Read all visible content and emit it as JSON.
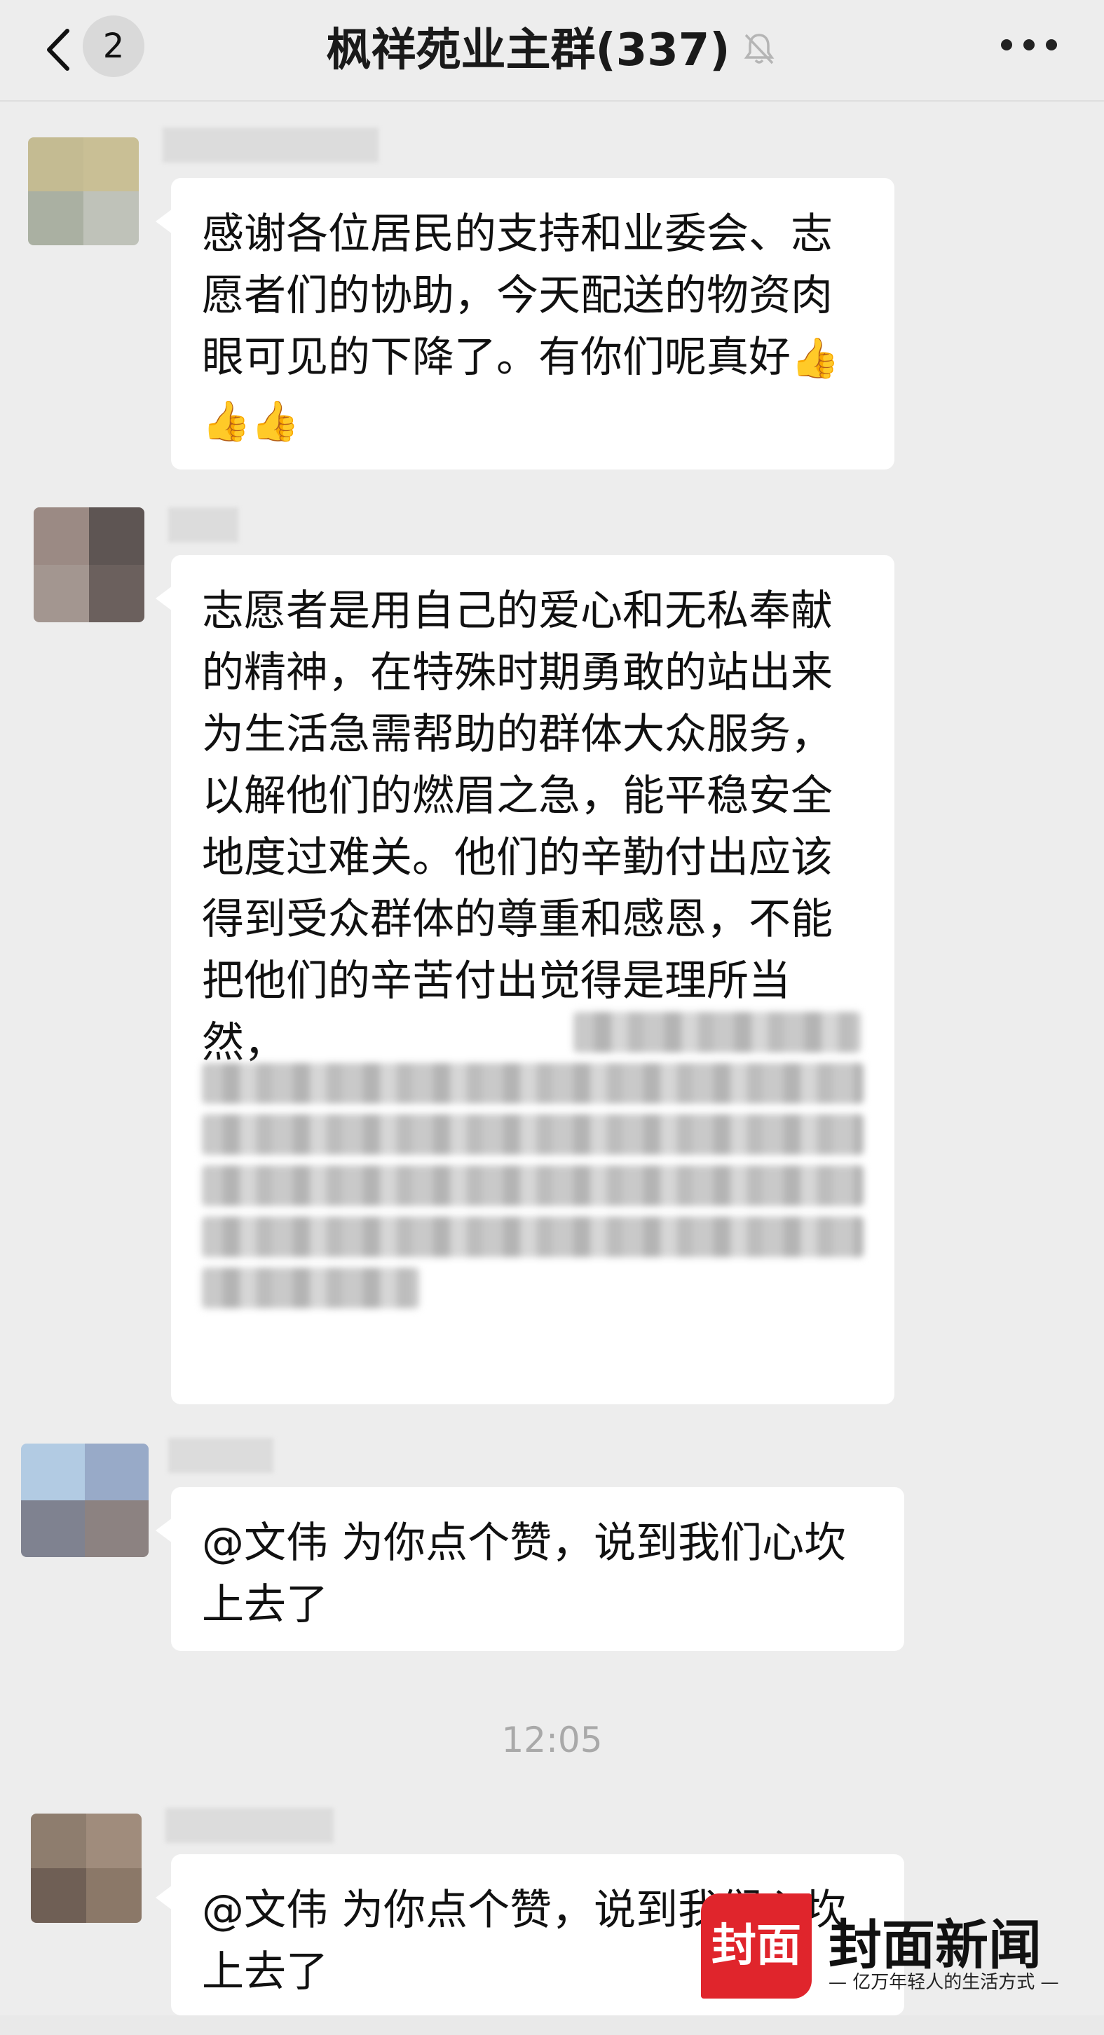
{
  "header": {
    "back_count": "2",
    "title": "枫祥苑业主群(337)",
    "mute_icon": "bell-muted-icon",
    "more_icon": "more-dots-icon"
  },
  "messages": [
    {
      "text": "感谢各位居民的支持和业委会、志愿者们的协助，今天配送的物资肉眼可见的下降了。有你们呢真好",
      "emoji": "👍👍👍"
    },
    {
      "text": "志愿者是用自己的爱心和无私奉献的精神，在特殊时期勇敢的站出来为生活急需帮助的群体大众服务，以解他们的燃眉之急，能平稳安全地度过难关。他们的辛勤付出应该得到受众群体的尊重和感恩，不能把他们的辛苦付出觉得是理所当然，"
    },
    {
      "text": "@文伟 为你点个赞，说到我们心坎上去了"
    },
    {
      "text": "@文伟 为你点个赞，说到我们心坎上去了"
    }
  ],
  "timestamp": "12:05",
  "watermark": {
    "badge": "封面",
    "name": "封面新闻",
    "slogan": "— 亿万年轻人的生活方式 —"
  },
  "colors": {
    "background": "#ededed",
    "bubble": "#ffffff",
    "brand_red": "#e0252c"
  }
}
